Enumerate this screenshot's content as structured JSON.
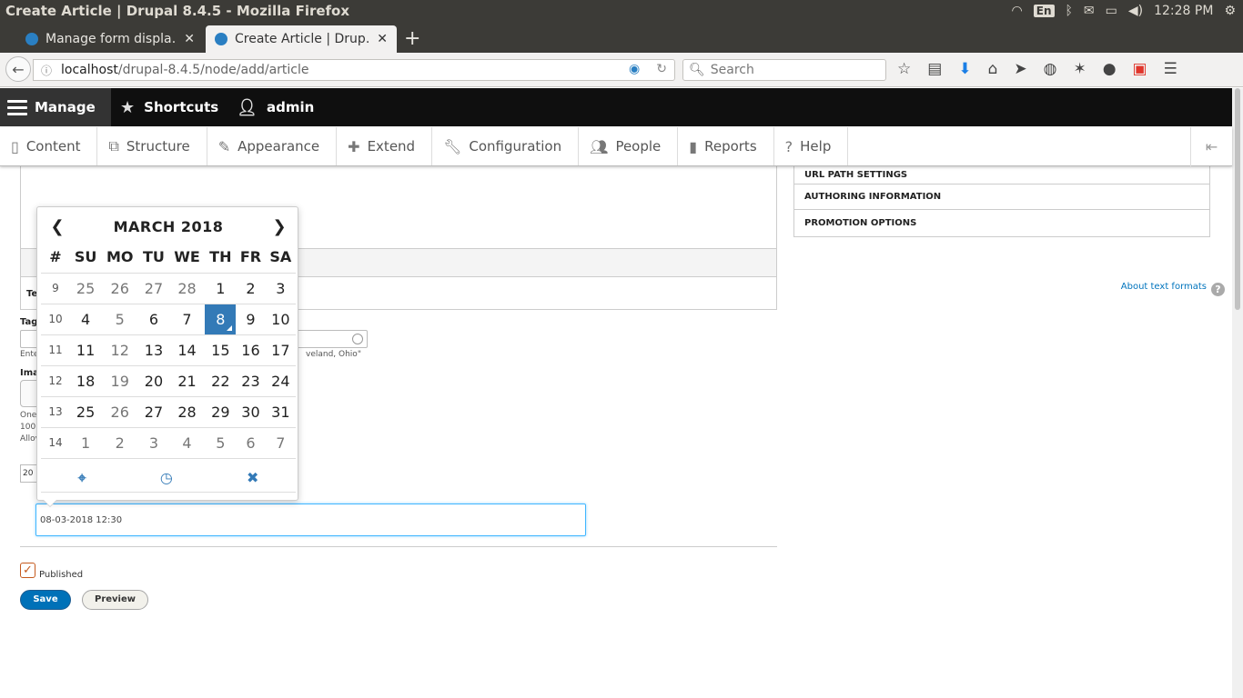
{
  "os": {
    "window_title": "Create Article | Drupal 8.4.5 - Mozilla Firefox",
    "lang": "En",
    "time": "12:28 PM"
  },
  "browser": {
    "tabs": [
      {
        "label": "Manage form displa…",
        "active": false
      },
      {
        "label": "Create Article | Drup…",
        "active": true
      }
    ],
    "url_host": "localhost",
    "url_path": "/drupal-8.4.5/node/add/article",
    "search_placeholder": "Search"
  },
  "toolbar": {
    "manage": "Manage",
    "shortcuts": "Shortcuts",
    "user": "admin"
  },
  "tray": {
    "items": [
      "Content",
      "Structure",
      "Appearance",
      "Extend",
      "Configuration",
      "People",
      "Reports",
      "Help"
    ]
  },
  "form": {
    "text_format_label": "Te",
    "about_text_formats": "About text formats",
    "tags_label": "Tag",
    "tags_description_left": "Ente",
    "tags_description_right": "veland, Ohio\"",
    "image_label": "Ima",
    "image_desc": [
      "One",
      "100",
      "Allov"
    ],
    "date_partial": "20",
    "datetime_value": "08-03-2018 12:30",
    "published_label": "Published",
    "save_label": "Save",
    "preview_label": "Preview"
  },
  "sidebar": {
    "rows": [
      "URL PATH SETTINGS",
      "AUTHORING INFORMATION",
      "PROMOTION OPTIONS"
    ]
  },
  "datepicker": {
    "month_label": "MARCH 2018",
    "headers": [
      "#",
      "SU",
      "MO",
      "TU",
      "WE",
      "TH",
      "FR",
      "SA"
    ],
    "weeks": [
      {
        "week": "9",
        "days": [
          "25",
          "26",
          "27",
          "28",
          "1",
          "2",
          "3"
        ]
      },
      {
        "week": "10",
        "days": [
          "4",
          "5",
          "6",
          "7",
          "8",
          "9",
          "10"
        ]
      },
      {
        "week": "11",
        "days": [
          "11",
          "12",
          "13",
          "14",
          "15",
          "16",
          "17"
        ]
      },
      {
        "week": "12",
        "days": [
          "18",
          "19",
          "20",
          "21",
          "22",
          "23",
          "24"
        ]
      },
      {
        "week": "13",
        "days": [
          "25",
          "26",
          "27",
          "28",
          "29",
          "30",
          "31"
        ]
      },
      {
        "week": "14",
        "days": [
          "1",
          "2",
          "3",
          "4",
          "5",
          "6",
          "7"
        ]
      }
    ],
    "selected": "8",
    "accent": "#337ab7"
  }
}
